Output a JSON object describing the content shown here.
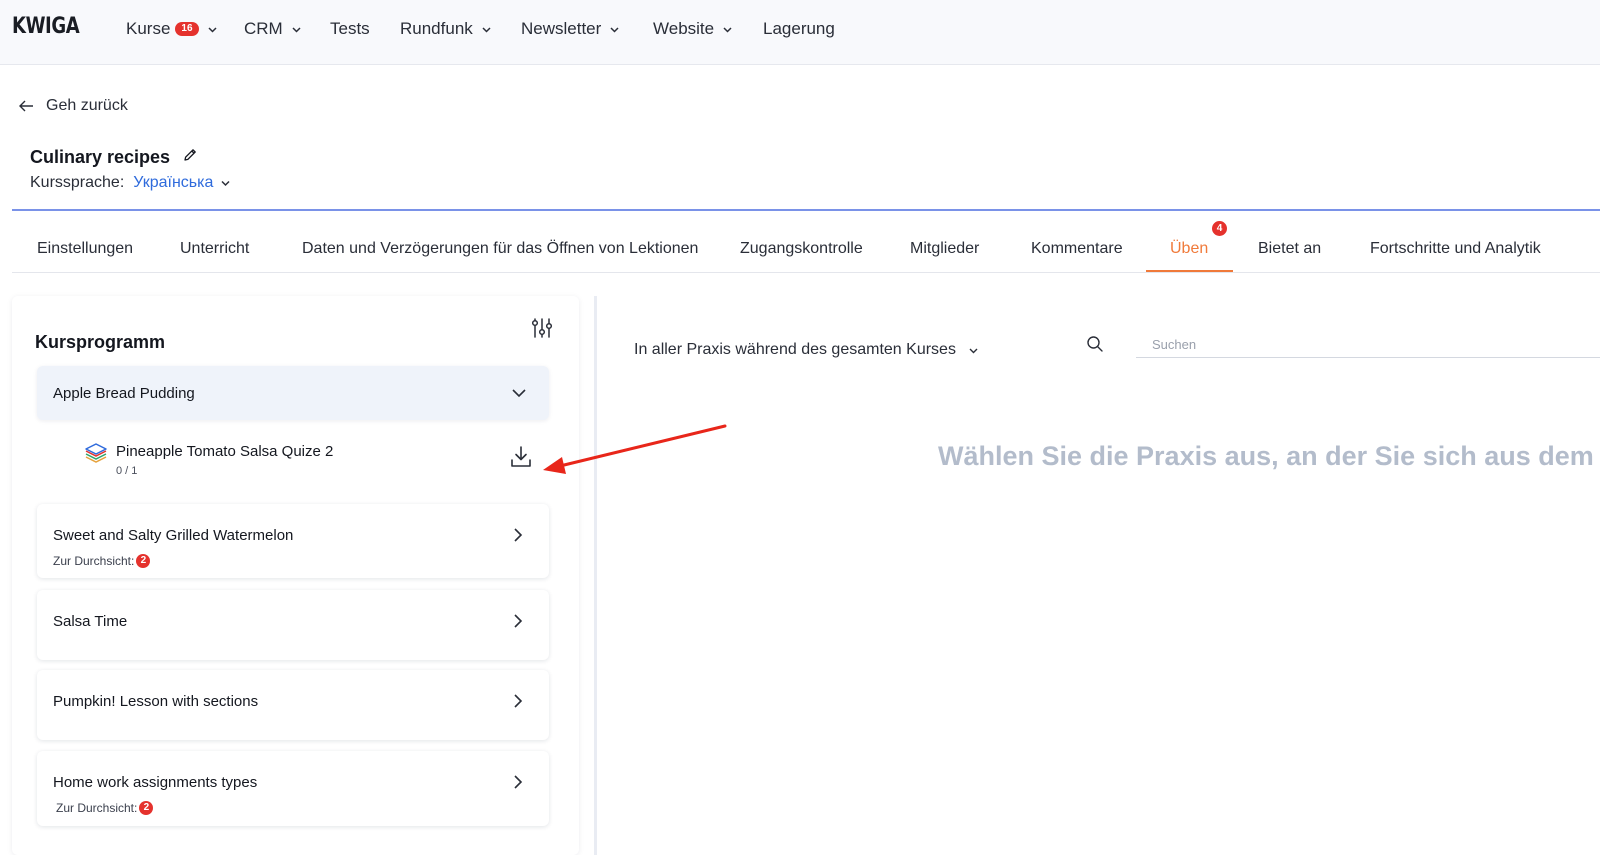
{
  "app": {
    "logo": "KWIGA"
  },
  "nav": {
    "items": [
      {
        "label": "Kurse",
        "badge": "16",
        "dropdown": true
      },
      {
        "label": "CRM",
        "dropdown": true
      },
      {
        "label": "Tests",
        "dropdown": false
      },
      {
        "label": "Rundfunk",
        "dropdown": true
      },
      {
        "label": "Newsletter",
        "dropdown": true
      },
      {
        "label": "Website",
        "dropdown": true
      },
      {
        "label": "Lagerung",
        "dropdown": false
      }
    ]
  },
  "back": {
    "label": "Geh zurück"
  },
  "course": {
    "title": "Culinary recipes",
    "language_label": "Kurssprache:",
    "language_value": "Українська"
  },
  "tabs": [
    {
      "label": "Einstellungen"
    },
    {
      "label": "Unterricht"
    },
    {
      "label": "Daten und Verzögerungen für das Öffnen von Lektionen"
    },
    {
      "label": "Zugangskontrolle"
    },
    {
      "label": "Mitglieder"
    },
    {
      "label": "Kommentare"
    },
    {
      "label": "Üben",
      "badge": "4",
      "active": true
    },
    {
      "label": "Bietet an"
    },
    {
      "label": "Fortschritte und Analytik"
    }
  ],
  "program": {
    "title": "Kursprogramm",
    "lessons": [
      {
        "name": "Apple Bread Pudding",
        "expanded": true
      },
      {
        "name": "Sweet and Salty Grilled Watermelon",
        "review_label": "Zur Durchsicht:",
        "review_count": "2"
      },
      {
        "name": "Salsa Time"
      },
      {
        "name": "Pumpkin! Lesson with sections"
      },
      {
        "name": "Home work assignments types",
        "review_label": "Zur Durchsicht:",
        "review_count": "2"
      }
    ],
    "quiz": {
      "name": "Pineapple Tomato Salsa Quize 2",
      "progress": "0 / 1"
    }
  },
  "practice": {
    "filter_label": "In aller Praxis während des gesamten Kurses",
    "search_placeholder": "Suchen",
    "empty_hint": "Wählen Sie die Praxis aus, an der Sie sich aus dem l"
  },
  "colors": {
    "accent_orange": "#f07a3a",
    "badge_red": "#e5322d",
    "link_blue": "#2f6bdc",
    "annotation_arrow": "#e8261a"
  }
}
